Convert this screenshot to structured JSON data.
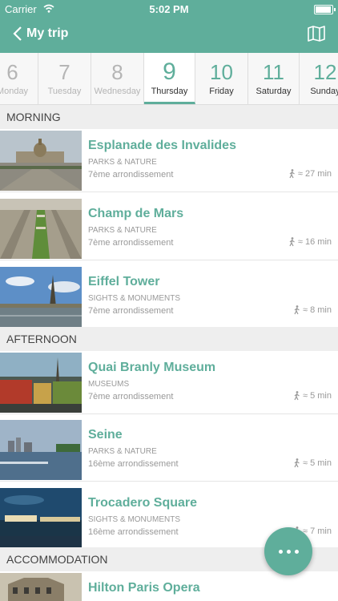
{
  "status": {
    "carrier": "Carrier",
    "time": "5:02 PM",
    "battery_level": 0.95
  },
  "nav": {
    "back_label": "My trip"
  },
  "days": [
    {
      "num": "6",
      "name": "Monday",
      "state": "past"
    },
    {
      "num": "7",
      "name": "Tuesday",
      "state": "past"
    },
    {
      "num": "8",
      "name": "Wednesday",
      "state": "past"
    },
    {
      "num": "9",
      "name": "Thursday",
      "state": "active"
    },
    {
      "num": "10",
      "name": "Friday",
      "state": "future"
    },
    {
      "num": "11",
      "name": "Saturday",
      "state": "future"
    },
    {
      "num": "12",
      "name": "Sunday",
      "state": "future"
    }
  ],
  "sections": {
    "morning": "MORNING",
    "afternoon": "AFTERNOON",
    "accommodation": "ACCOMMODATION"
  },
  "places": [
    {
      "title": "Esplanade des Invalides",
      "category": "PARKS & NATURE",
      "area": "7ème arrondissement",
      "walk": "≈ 27 min"
    },
    {
      "title": "Champ de Mars",
      "category": "PARKS & NATURE",
      "area": "7ème arrondissement",
      "walk": "≈ 16 min"
    },
    {
      "title": "Eiffel Tower",
      "category": "SIGHTS & MONUMENTS",
      "area": "7ème arrondissement",
      "walk": "≈ 8 min"
    },
    {
      "title": "Quai Branly Museum",
      "category": "MUSEUMS",
      "area": "7ème arrondissement",
      "walk": "≈ 5 min"
    },
    {
      "title": "Seine",
      "category": "PARKS & NATURE",
      "area": "16ème arrondissement",
      "walk": "≈ 5 min"
    },
    {
      "title": "Trocadero Square",
      "category": "SIGHTS & MONUMENTS",
      "area": "16ème arrondissement",
      "walk": "≈ 7 min"
    },
    {
      "title": "Hilton Paris Opera",
      "category": "",
      "area": "",
      "walk": ""
    }
  ],
  "colors": {
    "accent": "#5fae9b"
  },
  "icons": {
    "back": "chevron-left-icon",
    "map": "map-icon",
    "walk": "walking-person-icon",
    "more": "more-dots-icon"
  }
}
